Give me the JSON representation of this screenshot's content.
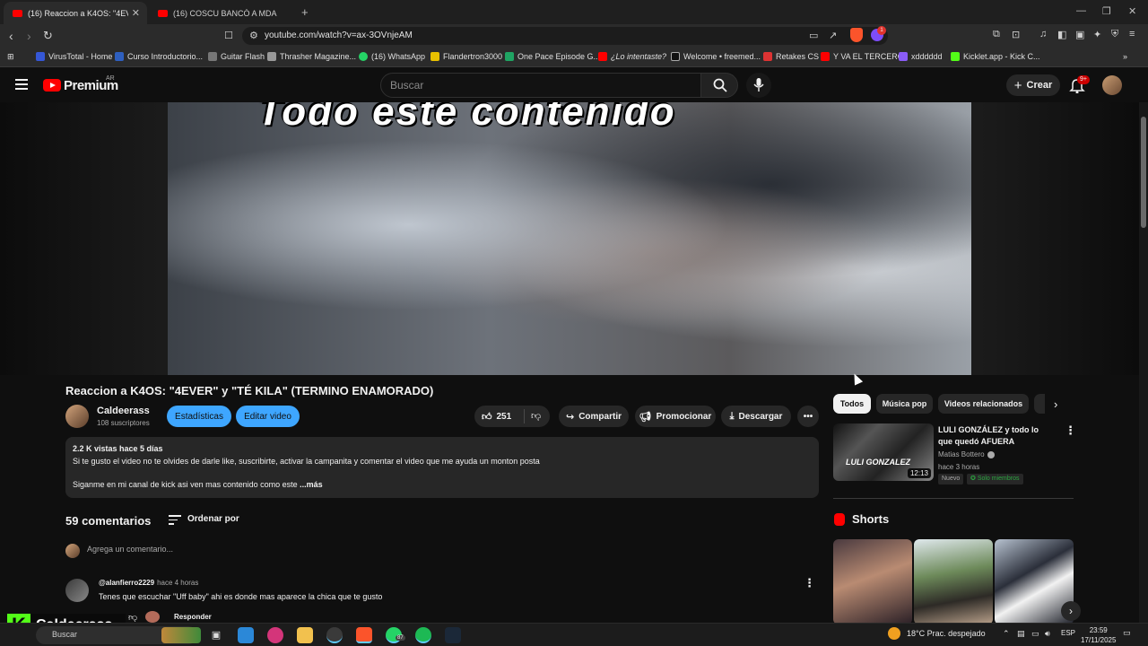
{
  "browser": {
    "tabs": [
      {
        "label": "(16) Reaccion a K4OS: \"4EVER\" y",
        "active": true
      },
      {
        "label": "(16) COSCU BANCÓ A MDA NOTICIA",
        "active": false
      }
    ],
    "url": "youtube.com/watch?v=ax-3OVnjeAM",
    "bookmarks": [
      "VirusTotal - Home",
      "Curso Introductorio...",
      "Guitar Flash",
      "Thrasher Magazine...",
      "(16) WhatsApp",
      "Flandertron3000",
      "One Pace Episode G...",
      "¿Lo intentaste?",
      "Welcome • freemed...",
      "Retakes CS",
      "Y VA EL TERCERO",
      "xdddddd",
      "Kicklet.app - Kick C..."
    ],
    "rewards_badge": "1"
  },
  "youtube": {
    "logo_text": "Premium",
    "country": "AR",
    "search_placeholder": "Buscar",
    "create_label": "Crear",
    "notif_count": "9+"
  },
  "video": {
    "caption": "Todo este contenido",
    "title": "Reaccion a K4OS: \"4EVER\" y \"TÉ KILA\" (TERMINO ENAMORADO)",
    "channel": "Caldeerass",
    "subscribers": "108 suscriptores",
    "stats_button": "Estadísticas",
    "edit_button": "Editar video",
    "likes": "251",
    "share": "Compartir",
    "promote": "Promocionar",
    "download": "Descargar",
    "description": {
      "stats": "2.2 K vistas  hace 5 días",
      "line1": "Si te gusto el video no te olvides de darle like, suscribirte, activar la campanita y comentar el video que me ayuda un monton posta",
      "line2": "Siganme en mi canal de kick asi ven mas contenido como este",
      "more": "...más"
    }
  },
  "comments": {
    "count": "59 comentarios",
    "sort_label": "Ordenar por",
    "add_placeholder": "Agrega un comentario...",
    "items": [
      {
        "user": "@alanfierro2229",
        "time": "hace 4 horas",
        "text": "Tenes que escuchar \"Uff baby\" ahi es donde mas aparece la chica que te gusto",
        "reply": "Responder"
      }
    ]
  },
  "overlay": {
    "kick_letter": "K",
    "kick_name": "Caldeerass"
  },
  "sidebar": {
    "chips": [
      "Todos",
      "Música pop",
      "Videos relacionados"
    ],
    "recommended": [
      {
        "title": "LULI GONZÁLEZ y todo lo que quedó AFUERA",
        "channel": "Matias Bottero",
        "time": "hace 3 horas",
        "duration": "12:13",
        "badge_new": "Nuevo",
        "badge_members": "Solo miembros",
        "thumb_text": "LULI GONZALEZ"
      }
    ],
    "shorts_label": "Shorts"
  },
  "taskbar": {
    "search": "Buscar",
    "whatsapp_badge": "87",
    "temp": "18°C  Prac. despejado",
    "lang": "ESP",
    "time": "23:59",
    "date": "17/11/2025"
  }
}
